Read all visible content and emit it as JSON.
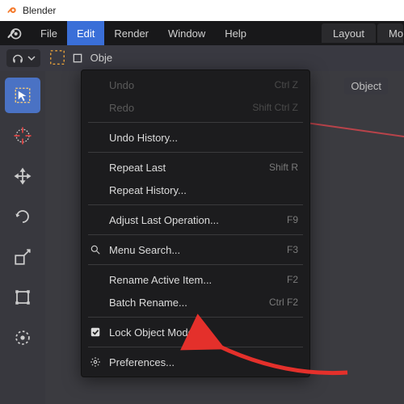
{
  "titlebar": {
    "app_name": "Blender"
  },
  "menubar": {
    "file": "File",
    "edit": "Edit",
    "render": "Render",
    "window": "Window",
    "help": "Help"
  },
  "workspace": {
    "layout": "Layout",
    "modeling": "Mo"
  },
  "toolbar": {
    "object_mode": "Obje"
  },
  "viewport": {
    "object_label": "Object"
  },
  "edit_menu": {
    "undo": {
      "label": "Undo",
      "shortcut": "Ctrl Z"
    },
    "redo": {
      "label": "Redo",
      "shortcut": "Shift Ctrl Z"
    },
    "undo_history": {
      "label": "Undo History..."
    },
    "repeat_last": {
      "label": "Repeat Last",
      "shortcut": "Shift R"
    },
    "repeat_history": {
      "label": "Repeat History..."
    },
    "adjust_last": {
      "label": "Adjust Last Operation...",
      "shortcut": "F9"
    },
    "menu_search": {
      "label": "Menu Search...",
      "shortcut": "F3"
    },
    "rename_active": {
      "label": "Rename Active Item...",
      "shortcut": "F2"
    },
    "batch_rename": {
      "label": "Batch Rename...",
      "shortcut": "Ctrl F2"
    },
    "lock_modes": {
      "label": "Lock Object Modes"
    },
    "preferences": {
      "label": "Preferences..."
    }
  }
}
